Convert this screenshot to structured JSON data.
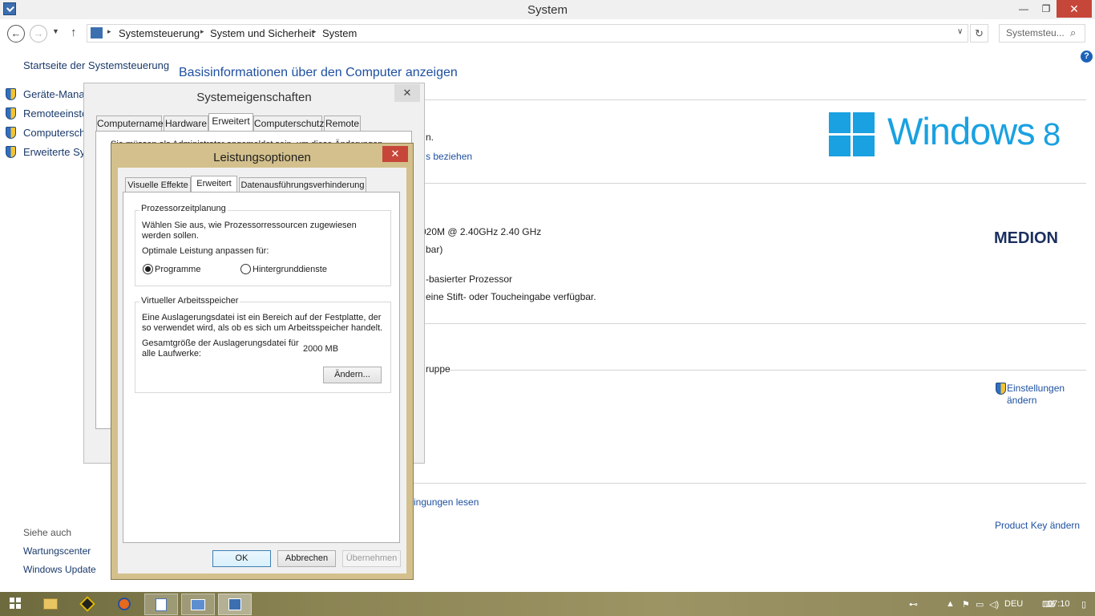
{
  "window": {
    "title": "System",
    "min_glyph": "—",
    "max_glyph": "❐",
    "close_glyph": "✕"
  },
  "nav": {
    "back_glyph": "←",
    "forward_glyph": "→",
    "history_glyph": "▼",
    "up_glyph": "↑",
    "breadcrumbs": [
      "Systemsteuerung",
      "System und Sicherheit",
      "System"
    ],
    "sep_glyph": "▸",
    "dropdown_glyph": "∨",
    "refresh_glyph": "↻",
    "search_placeholder": "Systemsteu...",
    "search_glyph": "⌕"
  },
  "help_glyph": "?",
  "left_pane": {
    "home_link": "Startseite der Systemsteuerung",
    "links": [
      "Geräte-Manag",
      "Remoteeinstel",
      "Computerschu",
      "Erweiterte Syst"
    ],
    "see_also_title": "Siehe auch",
    "see_also": [
      "Wartungscenter",
      "Windows Update"
    ]
  },
  "main": {
    "heading": "Basisinformationen über den Computer anzeigen",
    "edition_text": "n.",
    "edition_link": "s beziehen",
    "processor": "020M @ 2.40GHz   2.40 GHz",
    "ram": "bar)",
    "system_type": "-basierter Prozessor",
    "pen_touch": "eine Stift- oder Toucheingabe verfügbar.",
    "workgroup": "ruppe",
    "settings_link": [
      "Einstellungen",
      "ändern"
    ],
    "activation_link": "ingungen lesen",
    "product_key_link": "Product Key ändern",
    "windows_logo_text": "Windows",
    "windows_logo_number": "8",
    "oem_logo": "MEDION"
  },
  "sys_dialog": {
    "title": "Systemeigenschaften",
    "close_glyph": "✕",
    "tabs": [
      "Computername",
      "Hardware",
      "Erweitert",
      "Computerschutz",
      "Remote"
    ],
    "active_tab": "Erweitert",
    "text": "Sie müssen als Administrator angemeldet sein, um diese Änderungen"
  },
  "perf_dialog": {
    "title": "Leistungsoptionen",
    "close_glyph": "✕",
    "tabs": [
      "Visuelle Effekte",
      "Erweitert",
      "Datenausführungsverhinderung"
    ],
    "active_tab": "Erweitert",
    "cpu_group": {
      "title": "Prozessorzeitplanung",
      "description": "Wählen Sie aus, wie Prozessorressourcen zugewiesen werden sollen.",
      "prompt": "Optimale Leistung anpassen für:",
      "options": [
        "Programme",
        "Hintergrunddienste"
      ],
      "selected": "Programme"
    },
    "vm_group": {
      "title": "Virtueller Arbeitsspeicher",
      "description": "Eine Auslagerungsdatei ist ein Bereich auf der Festplatte, der so verwendet wird, als ob es sich um Arbeitsspeicher handelt.",
      "total_label": "Gesamtgröße der Auslagerungsdatei für alle Laufwerke:",
      "total_value": "2000 MB",
      "change_button": "Ändern..."
    },
    "buttons": {
      "ok": "OK",
      "cancel": "Abbrechen",
      "apply": "Übernehmen"
    }
  },
  "taskbar": {
    "language": "DEU",
    "time": "07:10"
  }
}
